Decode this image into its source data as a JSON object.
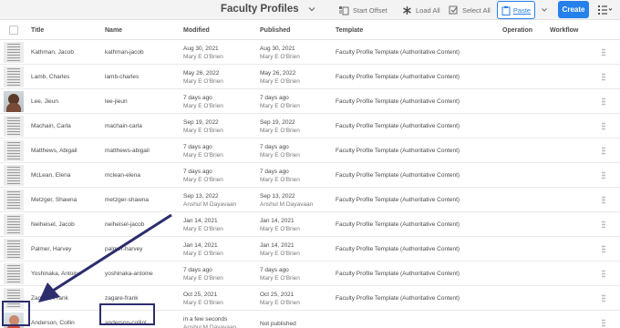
{
  "toolbar": {
    "title": "Faculty Profiles",
    "start_offset": "Start Offset",
    "load_all": "Load All",
    "select_all": "Select All",
    "paste": "Paste",
    "create": "Create",
    "accent": "#2680eb"
  },
  "columns": {
    "title": "Title",
    "name": "Name",
    "modified": "Modified",
    "published": "Published",
    "template": "Template",
    "operation": "Operation",
    "workflow": "Workflow"
  },
  "rows": [
    {
      "thumb": "doc",
      "title": "Kathman, Jacob",
      "name": "kathman-jacob",
      "modified": "Aug 30, 2021",
      "modified_by": "Mary E O'Brien",
      "published": "Aug 30, 2021",
      "published_by": "Mary E O'Brien",
      "template": "Faculty Profile Template (Authoritative Content)"
    },
    {
      "thumb": "doc",
      "title": "Lamb, Charles",
      "name": "lamb-charles",
      "modified": "May 26, 2022",
      "modified_by": "Mary E O'Brien",
      "published": "May 26, 2022",
      "published_by": "Mary E O'Brien",
      "template": "Faculty Profile Template (Authoritative Content)"
    },
    {
      "thumb": "photo",
      "title": "Lee, Jieun",
      "name": "lee-jieun",
      "modified": "7 days ago",
      "modified_by": "Mary E O'Brien",
      "published": "7 days ago",
      "published_by": "Mary E O'Brien",
      "template": "Faculty Profile Template (Authoritative Content)"
    },
    {
      "thumb": "doc",
      "title": "Machain, Carla",
      "name": "machain-carla",
      "modified": "Sep 19, 2022",
      "modified_by": "Mary E O'Brien",
      "published": "Sep 19, 2022",
      "published_by": "Mary E O'Brien",
      "template": "Faculty Profile Template (Authoritative Content)"
    },
    {
      "thumb": "doc",
      "title": "Matthews, Abigail",
      "name": "matthews-abigail",
      "modified": "7 days ago",
      "modified_by": "Mary E O'Brien",
      "published": "7 days ago",
      "published_by": "Mary E O'Brien",
      "template": "Faculty Profile Template (Authoritative Content)"
    },
    {
      "thumb": "doc",
      "title": "McLean, Elena",
      "name": "mclean-elena",
      "modified": "7 days ago",
      "modified_by": "Mary E O'Brien",
      "published": "7 days ago",
      "published_by": "Mary E O'Brien",
      "template": "Faculty Profile Template (Authoritative Content)"
    },
    {
      "thumb": "doc",
      "title": "Metzger, Shawna",
      "name": "metzger-shawna",
      "modified": "Sep 13, 2022",
      "modified_by": "Anshul M Dayavaan",
      "published": "Sep 13, 2022",
      "published_by": "Anshul M Dayavaan",
      "template": "Faculty Profile Template (Authoritative Content)"
    },
    {
      "thumb": "doc",
      "title": "Neiheisel, Jacob",
      "name": "neiheisel-jacob",
      "modified": "Jan 14, 2021",
      "modified_by": "Mary E O'Brien",
      "published": "Jan 14, 2021",
      "published_by": "Mary E O'Brien",
      "template": "Faculty Profile Template (Authoritative Content)"
    },
    {
      "thumb": "doc",
      "title": "Palmer, Harvey",
      "name": "palmer-harvey",
      "modified": "Jan 14, 2021",
      "modified_by": "Mary E O'Brien",
      "published": "Jan 14, 2021",
      "published_by": "Mary E O'Brien",
      "template": "Faculty Profile Template (Authoritative Content)"
    },
    {
      "thumb": "doc",
      "title": "Yoshinaka, Antoine",
      "name": "yoshinaka-antoine",
      "modified": "7 days ago",
      "modified_by": "Mary E O'Brien",
      "published": "7 days ago",
      "published_by": "Mary E O'Brien",
      "template": "Faculty Profile Template (Authoritative Content)"
    },
    {
      "thumb": "doc",
      "title": "Zagare, Frank",
      "name": "zagare-frank",
      "modified": "Oct 25, 2021",
      "modified_by": "Mary E O'Brien",
      "published": "Oct 25, 2021",
      "published_by": "Mary E O'Brien",
      "template": "Faculty Profile Template (Authoritative Content)"
    },
    {
      "thumb": "photo2",
      "title": "Anderson, Collin",
      "name": "anderson-collinl",
      "modified": "in a few seconds",
      "modified_by": "Anshul M Dayavaan",
      "published": "Not published",
      "published_by": "",
      "template": ""
    }
  ],
  "annotation": {
    "color": "#2c2d6e"
  }
}
